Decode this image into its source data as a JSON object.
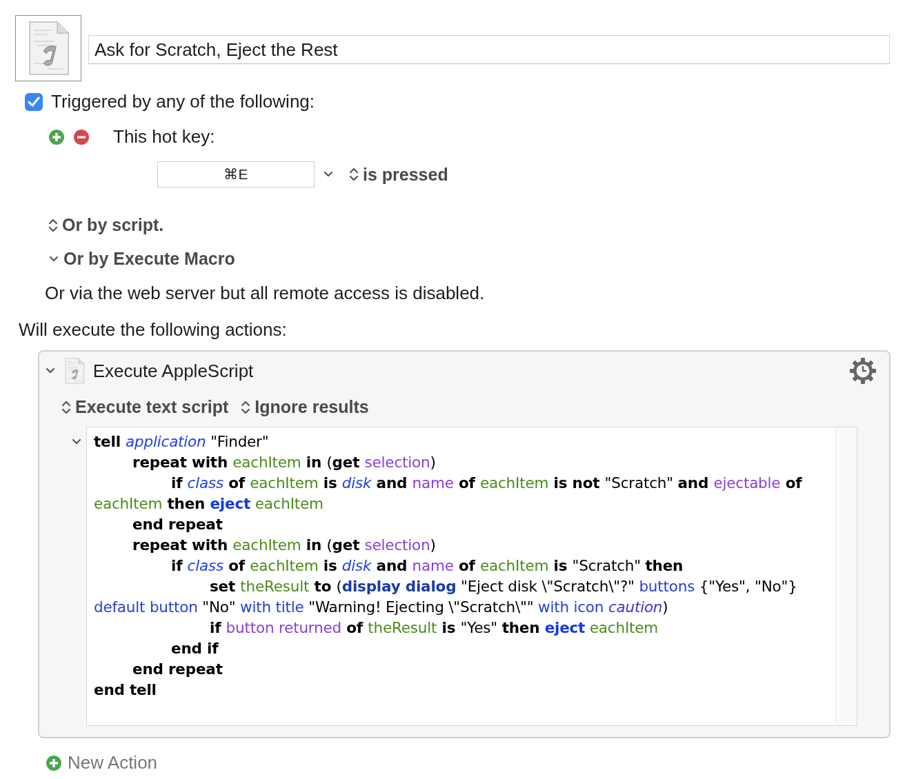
{
  "macro": {
    "name": "Ask for Scratch, Eject the Rest"
  },
  "trigger": {
    "label": "Triggered by any of the following:",
    "checked": true
  },
  "hotkey": {
    "label": "This hot key:",
    "key": "⌘E",
    "condition": "is pressed"
  },
  "options": [
    {
      "label": "Or by script.",
      "kind": "popup"
    },
    {
      "label": "Or by Execute Macro",
      "kind": "disclosure",
      "expanded": true
    }
  ],
  "web_server_note": "Or via the web server but all remote access is disabled.",
  "actions_label": "Will execute the following actions:",
  "action": {
    "title": "Execute AppleScript",
    "expanded": true,
    "popups": [
      "Execute text script",
      "Ignore results"
    ],
    "script_expanded": true,
    "script": [
      {
        "tokens": [
          {
            "kind": "keyword",
            "text": "tell "
          },
          {
            "kind": "class",
            "text": "application"
          },
          {
            "kind": "plain",
            "text": " \"Finder\""
          }
        ],
        "children": [
          {
            "tokens": [
              {
                "kind": "keyword",
                "text": "repeat with "
              },
              {
                "kind": "variable",
                "text": "eachItem"
              },
              {
                "kind": "keyword",
                "text": " in "
              },
              {
                "kind": "plain",
                "text": "("
              },
              {
                "kind": "keyword",
                "text": "get "
              },
              {
                "kind": "property",
                "text": "selection"
              },
              {
                "kind": "plain",
                "text": ")"
              }
            ],
            "children": [
              {
                "tokens": [
                  {
                    "kind": "keyword",
                    "text": "if "
                  },
                  {
                    "kind": "class",
                    "text": "class"
                  },
                  {
                    "kind": "keyword",
                    "text": " of "
                  },
                  {
                    "kind": "variable",
                    "text": "eachItem"
                  },
                  {
                    "kind": "keyword",
                    "text": " is "
                  },
                  {
                    "kind": "class",
                    "text": "disk"
                  },
                  {
                    "kind": "keyword",
                    "text": " and "
                  },
                  {
                    "kind": "property",
                    "text": "name"
                  },
                  {
                    "kind": "keyword",
                    "text": " of "
                  },
                  {
                    "kind": "variable",
                    "text": "eachItem"
                  },
                  {
                    "kind": "keyword",
                    "text": " is not "
                  },
                  {
                    "kind": "plain",
                    "text": "\"Scratch\" "
                  },
                  {
                    "kind": "keyword",
                    "text": "and "
                  },
                  {
                    "kind": "property",
                    "text": "ejectable"
                  },
                  {
                    "kind": "keyword",
                    "text": " of "
                  },
                  {
                    "kind": "variable",
                    "text": "eachItem"
                  },
                  {
                    "kind": "keyword",
                    "text": " then "
                  },
                  {
                    "kind": "command",
                    "text": "eject"
                  },
                  {
                    "kind": "variable",
                    "text": " eachItem"
                  }
                ]
              }
            ]
          },
          {
            "tokens": [
              {
                "kind": "keyword",
                "text": "end repeat"
              }
            ]
          },
          {
            "tokens": [
              {
                "kind": "keyword",
                "text": "repeat with "
              },
              {
                "kind": "variable",
                "text": "eachItem"
              },
              {
                "kind": "keyword",
                "text": " in "
              },
              {
                "kind": "plain",
                "text": "("
              },
              {
                "kind": "keyword",
                "text": "get "
              },
              {
                "kind": "property",
                "text": "selection"
              },
              {
                "kind": "plain",
                "text": ")"
              }
            ],
            "children": [
              {
                "tokens": [
                  {
                    "kind": "keyword",
                    "text": "if "
                  },
                  {
                    "kind": "class",
                    "text": "class"
                  },
                  {
                    "kind": "keyword",
                    "text": " of "
                  },
                  {
                    "kind": "variable",
                    "text": "eachItem"
                  },
                  {
                    "kind": "keyword",
                    "text": " is "
                  },
                  {
                    "kind": "class",
                    "text": "disk"
                  },
                  {
                    "kind": "keyword",
                    "text": " and "
                  },
                  {
                    "kind": "property",
                    "text": "name"
                  },
                  {
                    "kind": "keyword",
                    "text": " of "
                  },
                  {
                    "kind": "variable",
                    "text": "eachItem"
                  },
                  {
                    "kind": "keyword",
                    "text": " is "
                  },
                  {
                    "kind": "plain",
                    "text": "\"Scratch\" "
                  },
                  {
                    "kind": "keyword",
                    "text": "then"
                  }
                ],
                "children": [
                  {
                    "tokens": [
                      {
                        "kind": "keyword",
                        "text": "set "
                      },
                      {
                        "kind": "variable",
                        "text": "theResult"
                      },
                      {
                        "kind": "keyword",
                        "text": " to "
                      },
                      {
                        "kind": "plain",
                        "text": "("
                      },
                      {
                        "kind": "dialog",
                        "text": "display dialog"
                      },
                      {
                        "kind": "plain",
                        "text": " \"Eject disk \\\"Scratch\\\"?\" "
                      },
                      {
                        "kind": "parameter",
                        "text": "buttons"
                      },
                      {
                        "kind": "plain",
                        "text": " {\"Yes\", \"No\"} "
                      },
                      {
                        "kind": "parameter",
                        "text": "default button"
                      },
                      {
                        "kind": "plain",
                        "text": " \"No\" "
                      },
                      {
                        "kind": "parameter",
                        "text": "with title"
                      },
                      {
                        "kind": "plain",
                        "text": " \"Warning! Ejecting \\\"Scratch\\\"\" "
                      },
                      {
                        "kind": "parameter",
                        "text": "with icon"
                      },
                      {
                        "kind": "constant",
                        "text": " caution"
                      },
                      {
                        "kind": "plain",
                        "text": ")"
                      }
                    ]
                  },
                  {
                    "tokens": [
                      {
                        "kind": "keyword",
                        "text": "if "
                      },
                      {
                        "kind": "property",
                        "text": "button returned"
                      },
                      {
                        "kind": "keyword",
                        "text": " of "
                      },
                      {
                        "kind": "variable",
                        "text": "theResult"
                      },
                      {
                        "kind": "keyword",
                        "text": " is "
                      },
                      {
                        "kind": "plain",
                        "text": "\"Yes\" "
                      },
                      {
                        "kind": "keyword",
                        "text": "then "
                      },
                      {
                        "kind": "command",
                        "text": "eject"
                      },
                      {
                        "kind": "variable",
                        "text": " eachItem"
                      }
                    ]
                  }
                ]
              },
              {
                "tokens": [
                  {
                    "kind": "keyword",
                    "text": "end if"
                  }
                ]
              }
            ]
          },
          {
            "tokens": [
              {
                "kind": "keyword",
                "text": "end repeat"
              }
            ]
          }
        ]
      },
      {
        "tokens": [
          {
            "kind": "keyword",
            "text": "end tell"
          }
        ]
      }
    ]
  },
  "new_action": "New Action"
}
